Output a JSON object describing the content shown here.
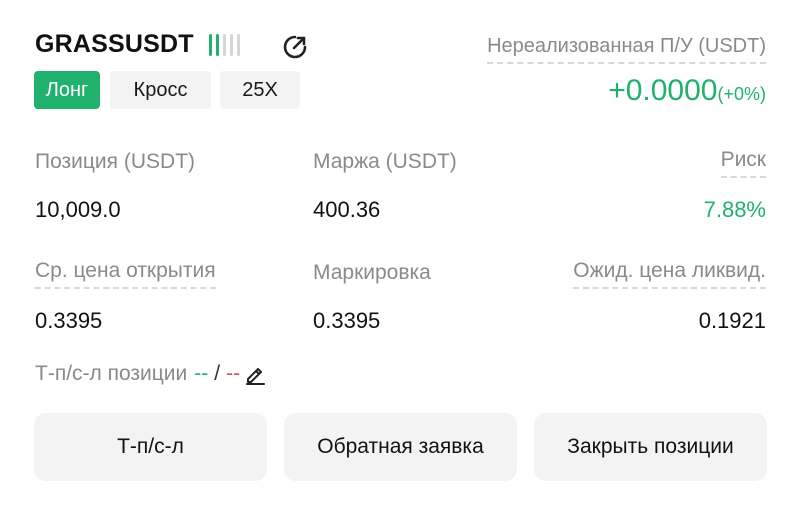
{
  "header": {
    "symbol": "GRASSUSDT",
    "tags": {
      "side": "Лонг",
      "margin_mode": "Кросс",
      "leverage": "25X"
    },
    "icons": [
      "signal-bars-icon",
      "share-icon"
    ]
  },
  "unrealized": {
    "label": "Нереализованная П/У (USDT)",
    "value": "+0.0000",
    "percent": "(+0%)"
  },
  "stats": {
    "position_label": "Позиция (USDT)",
    "position_value": "10,009.0",
    "margin_label": "Маржа (USDT)",
    "margin_value": "400.36",
    "risk_label": "Риск",
    "risk_value": "7.88%",
    "entry_label": "Ср. цена открытия",
    "entry_value": "0.3395",
    "mark_label": "Маркировка",
    "mark_value": "0.3395",
    "liq_label": "Ожид. цена ликвид.",
    "liq_value": "0.1921"
  },
  "tpsl": {
    "label": "Т-п/с-л позиции",
    "tp": "--",
    "separator": "/",
    "sl": "--"
  },
  "actions": {
    "tpsl_button": "Т-п/с-л",
    "reverse_button": "Обратная заявка",
    "close_button": "Закрыть позиции"
  },
  "colors": {
    "green": "#20b26c",
    "red": "#e0455b",
    "muted": "#8a8a8a",
    "button_bg": "#f3f3f3"
  }
}
